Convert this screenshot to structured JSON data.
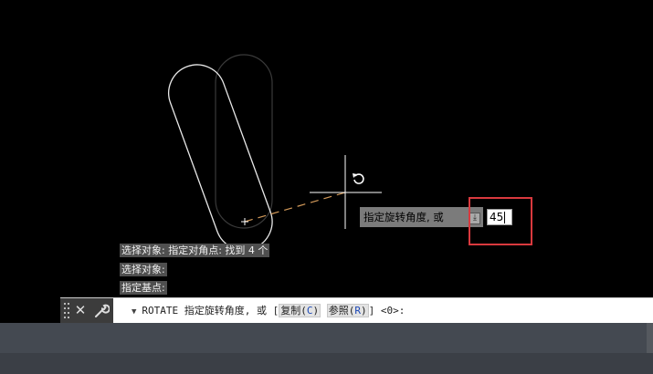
{
  "history": [
    "选择对象: 指定对角点: 找到 4 个",
    "选择对象:",
    "指定基点:"
  ],
  "tooltip": {
    "text": "指定旋转角度, 或",
    "arrow_icon": "down-arrow-icon"
  },
  "angle_input": {
    "value": "45"
  },
  "command_line": {
    "command": "ROTATE",
    "prompt": "指定旋转角度, 或",
    "open_bracket": "[",
    "option1_label": "复制",
    "option1_key": "C",
    "option2_label": "参照",
    "option2_key": "R",
    "close_bracket": "]",
    "default_value": "<0>:"
  },
  "tools": {
    "close_icon": "close-icon",
    "customize_icon": "wrench-icon",
    "grip_icon": "grip-icon"
  },
  "colors": {
    "background": "#000000",
    "highlight": "#d9393e",
    "rubberband": "#d39a5a",
    "option_key": "#1b47b5"
  }
}
